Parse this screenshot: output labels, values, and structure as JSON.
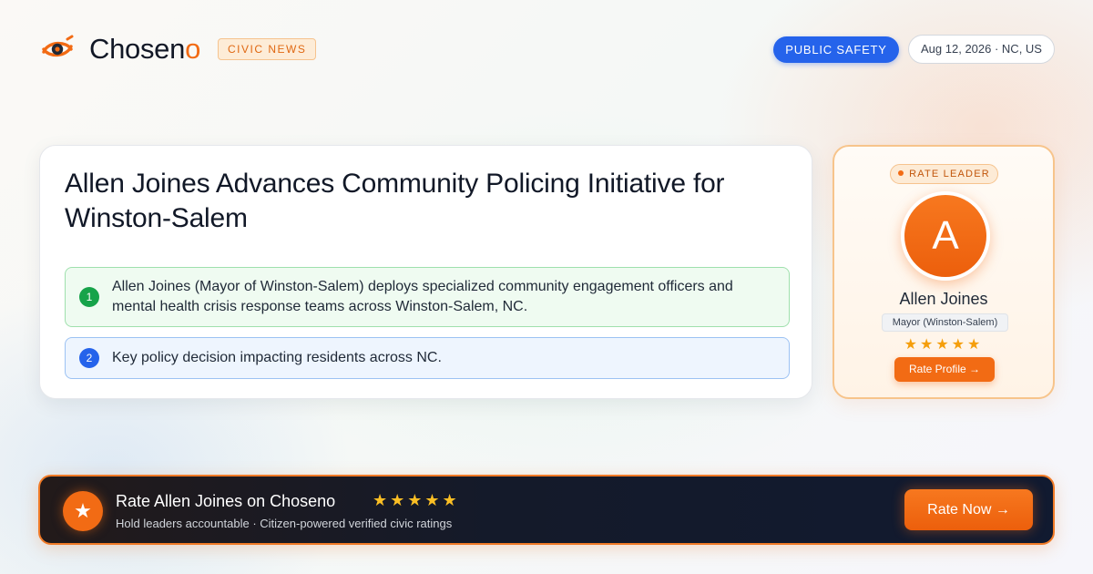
{
  "brand": {
    "name_main": "Chosen",
    "name_accent": "o",
    "logo_icon": "eye-orbit-logo-icon",
    "accent_color": "#f26b14"
  },
  "header": {
    "section_tag": "CIVIC NEWS",
    "category": "PUBLIC SAFETY",
    "date_location": "Aug 12, 2026 · NC, US",
    "category_color": "#2563eb"
  },
  "article": {
    "headline": "Allen Joines Advances Community Policing Initiative for Winston-Salem",
    "points": [
      {
        "number": "1",
        "text": "Allen Joines (Mayor of Winston-Salem) deploys specialized community engagement officers and mental health crisis response teams across Winston-Salem, NC.",
        "color": "#16a34a"
      },
      {
        "number": "2",
        "text": "Key policy decision impacting residents across NC.",
        "color": "#2563eb"
      }
    ]
  },
  "leader_card": {
    "badge": "RATE LEADER",
    "avatar_initial": "A",
    "name": "Allen Joines",
    "role": "Mayor (Winston-Salem)",
    "stars": "★★★★★",
    "button_label": "Rate Profile →"
  },
  "cta": {
    "icon": "star-icon",
    "icon_glyph": "★",
    "title": "Rate Allen Joines on Choseno",
    "stars": "★★★★★",
    "subtitle": "Hold leaders accountable · Citizen-powered verified civic ratings",
    "button_label": "Rate Now →"
  }
}
